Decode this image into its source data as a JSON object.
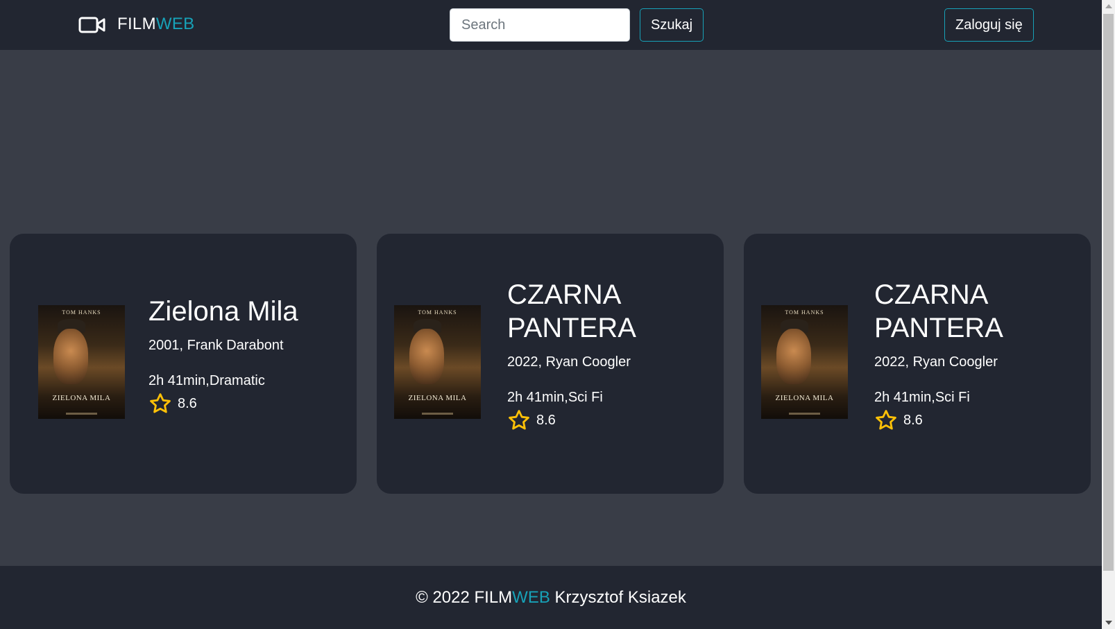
{
  "navbar": {
    "brand_main": "FILM",
    "brand_accent": "WEB",
    "search_placeholder": "Search",
    "search_button": "Szukaj",
    "login_button": "Zaloguj się"
  },
  "movies": [
    {
      "title": "Zielona Mila",
      "meta": "2001, Frank Darabont",
      "info": "2h 41min,Dramatic",
      "rating": "8.6",
      "poster_top": "TOM HANKS",
      "poster_title": "ZIELONA MILA"
    },
    {
      "title": "CZARNA PANTERA",
      "meta": "2022, Ryan Coogler",
      "info": "2h 41min,Sci Fi",
      "rating": "8.6",
      "poster_top": "TOM HANKS",
      "poster_title": "ZIELONA MILA"
    },
    {
      "title": "CZARNA PANTERA",
      "meta": "2022, Ryan Coogler",
      "info": "2h 41min,Sci Fi",
      "rating": "8.6",
      "poster_top": "TOM HANKS",
      "poster_title": "ZIELONA MILA"
    }
  ],
  "footer": {
    "prefix": "© 2022 FILM",
    "accent": "WEB",
    "suffix": " Krzysztof Ksiazek"
  },
  "colors": {
    "accent": "#17a2b8",
    "navbar_bg": "#222631",
    "page_bg": "#393d47",
    "star": "#ffc107"
  },
  "icons": {
    "brand": "video-camera-icon",
    "rating": "star-outline-icon"
  }
}
